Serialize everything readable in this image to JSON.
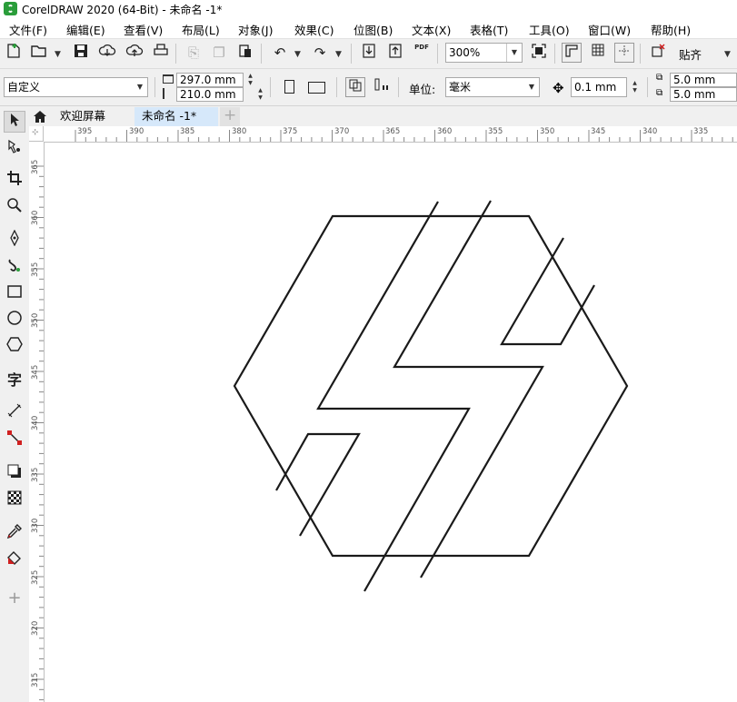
{
  "window": {
    "title": "CorelDRAW 2020 (64-Bit) - 未命名 -1*"
  },
  "menu": [
    "文件(F)",
    "编辑(E)",
    "查看(V)",
    "布局(L)",
    "对象(J)",
    "效果(C)",
    "位图(B)",
    "文本(X)",
    "表格(T)",
    "工具(O)",
    "窗口(W)",
    "帮助(H)"
  ],
  "toolbar": {
    "zoom": "300%",
    "pdf_label": "PDF",
    "snap_label": "贴齐"
  },
  "propbar": {
    "page_preset": "自定义",
    "page_width": "297.0 mm",
    "page_height": "210.0 mm",
    "units_label": "单位:",
    "units": "毫米",
    "nudge": "0.1 mm",
    "dup_x": "5.0 mm",
    "dup_y": "5.0 mm"
  },
  "tabs": {
    "welcome": "欢迎屏幕",
    "document": "未命名 -1*"
  },
  "ruler": {
    "h_ticks": [
      "395",
      "390",
      "385",
      "380",
      "375",
      "370",
      "365",
      "360",
      "355",
      "350",
      "345",
      "340",
      "335"
    ],
    "v_ticks": [
      "365",
      "360",
      "355",
      "350",
      "345",
      "340",
      "335",
      "330",
      "325",
      "320",
      "315"
    ]
  },
  "colors": {
    "accent_green": "#2a9d3a",
    "tab_active": "#d6e8fa",
    "stroke": "#1a1a1a"
  }
}
